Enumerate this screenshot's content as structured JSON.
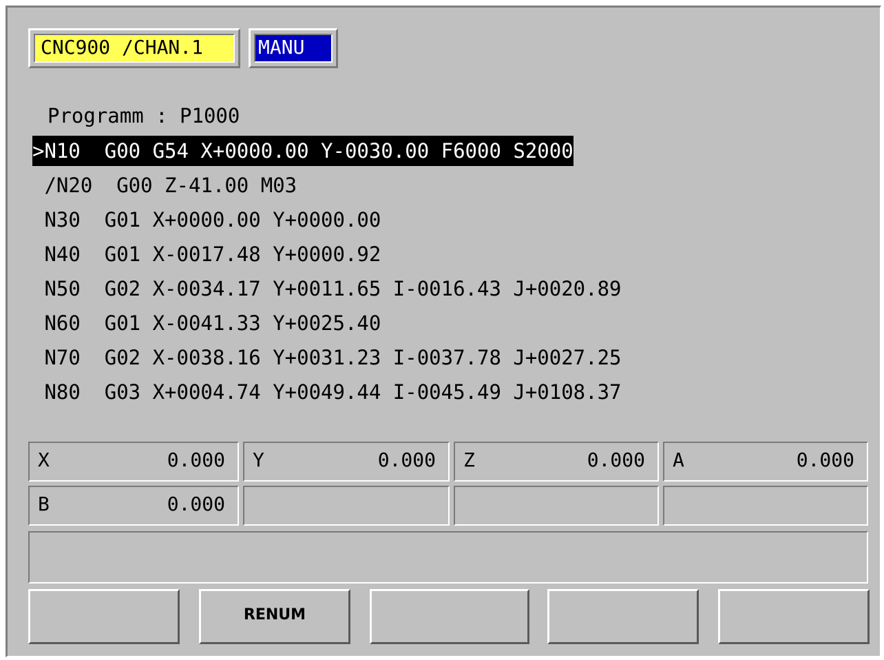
{
  "header": {
    "channel": "CNC900 /CHAN.1",
    "mode": "MANU"
  },
  "program": {
    "title": "Programm : P1000",
    "lines": [
      ">N10  G00 G54 X+0000.00 Y-0030.00 F6000 S2000",
      " /N20  G00 Z-41.00 M03",
      " N30  G01 X+0000.00 Y+0000.00",
      " N40  G01 X-0017.48 Y+0000.92",
      " N50  G02 X-0034.17 Y+0011.65 I-0016.43 J+0020.89",
      " N60  G01 X-0041.33 Y+0025.40",
      " N70  G02 X-0038.16 Y+0031.23 I-0037.78 J+0027.25",
      " N80  G03 X+0004.74 Y+0049.44 I-0045.49 J+0108.37"
    ],
    "active_line": 0
  },
  "axes": [
    {
      "name": "X",
      "value": "0.000"
    },
    {
      "name": "Y",
      "value": "0.000"
    },
    {
      "name": "Z",
      "value": "0.000"
    },
    {
      "name": "A",
      "value": "0.000"
    },
    {
      "name": "B",
      "value": "0.000"
    },
    {
      "name": "",
      "value": ""
    },
    {
      "name": "",
      "value": ""
    },
    {
      "name": "",
      "value": ""
    }
  ],
  "message": "",
  "softkeys": [
    "",
    "RENUM",
    "",
    "",
    ""
  ],
  "colors": {
    "background": "#c0c0c0",
    "channel_bg": "#ffff55",
    "mode_bg": "#0000c0",
    "active_line_bg": "#000000"
  }
}
